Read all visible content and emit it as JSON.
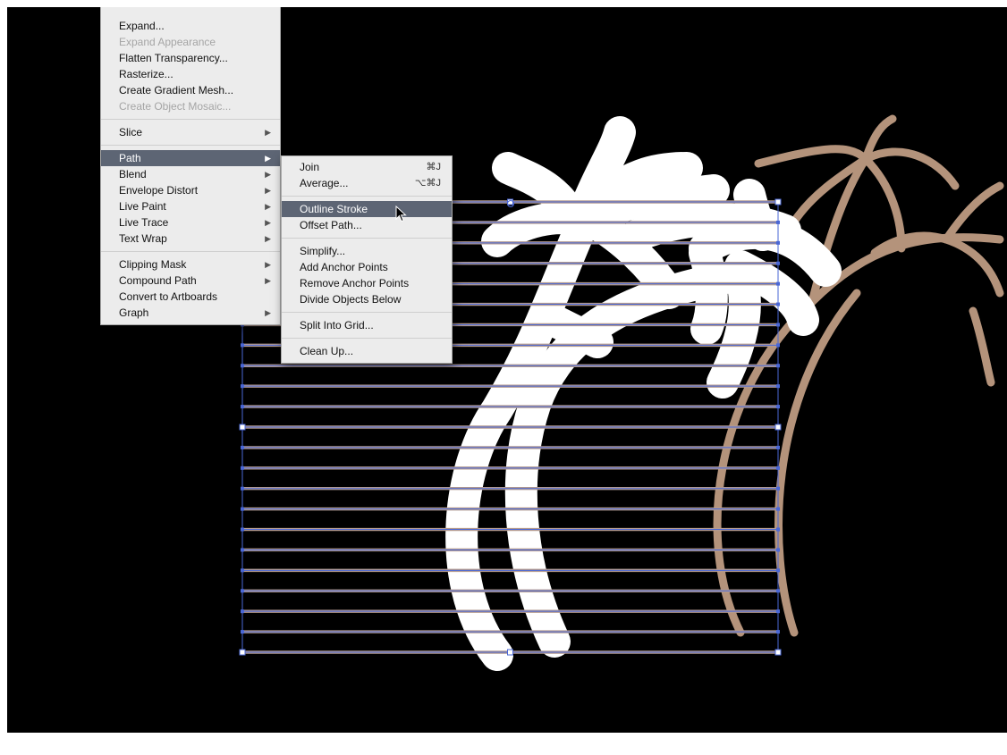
{
  "object_menu": {
    "groups": [
      [
        {
          "label": "Expand...",
          "enabled": true
        },
        {
          "label": "Expand Appearance",
          "enabled": false
        },
        {
          "label": "Flatten Transparency...",
          "enabled": true
        },
        {
          "label": "Rasterize...",
          "enabled": true
        },
        {
          "label": "Create Gradient Mesh...",
          "enabled": true
        },
        {
          "label": "Create Object Mosaic...",
          "enabled": false
        }
      ],
      [
        {
          "label": "Slice",
          "submenu": true
        }
      ],
      [
        {
          "label": "Path",
          "submenu": true,
          "selected": true
        },
        {
          "label": "Blend",
          "submenu": true
        },
        {
          "label": "Envelope Distort",
          "submenu": true
        },
        {
          "label": "Live Paint",
          "submenu": true
        },
        {
          "label": "Live Trace",
          "submenu": true
        },
        {
          "label": "Text Wrap",
          "submenu": true
        }
      ],
      [
        {
          "label": "Clipping Mask",
          "submenu": true
        },
        {
          "label": "Compound Path",
          "submenu": true
        },
        {
          "label": "Convert to Artboards"
        },
        {
          "label": "Graph",
          "submenu": true
        }
      ]
    ]
  },
  "path_submenu": {
    "groups": [
      [
        {
          "label": "Join",
          "shortcut": "⌘J"
        },
        {
          "label": "Average...",
          "shortcut": "⌥⌘J"
        }
      ],
      [
        {
          "label": "Outline Stroke",
          "selected": true
        },
        {
          "label": "Offset Path..."
        }
      ],
      [
        {
          "label": "Simplify..."
        },
        {
          "label": "Add Anchor Points"
        },
        {
          "label": "Remove Anchor Points"
        },
        {
          "label": "Divide Objects Below"
        }
      ],
      [
        {
          "label": "Split Into Grid..."
        }
      ],
      [
        {
          "label": "Clean Up..."
        }
      ]
    ]
  },
  "colors": {
    "canvas": "#000000",
    "palm_white": "#ffffff",
    "palm_tan": "#b4937b",
    "stripe": "#b39a8f",
    "selection": "#4a67d6",
    "menu_bg": "#ececec",
    "menu_highlight": "#5d6574"
  }
}
